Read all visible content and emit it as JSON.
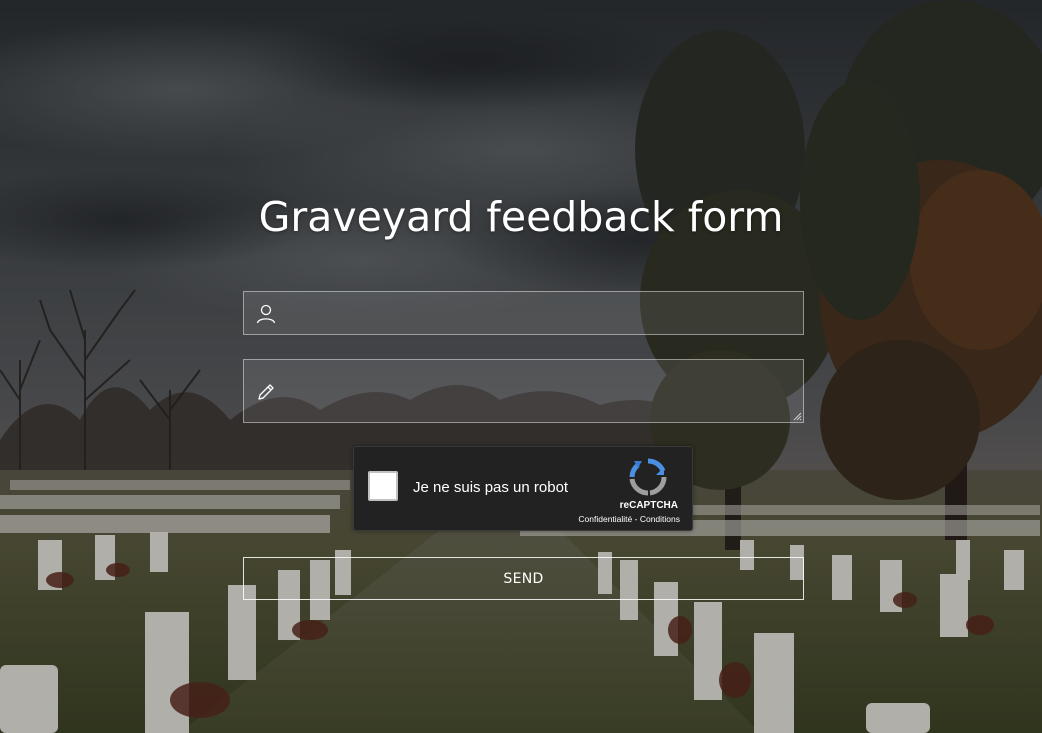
{
  "page": {
    "title": "Graveyard feedback form"
  },
  "form": {
    "name_icon": "user-icon",
    "message_icon": "pencil-icon",
    "name_value": "",
    "message_value": "",
    "send_label": "SEND"
  },
  "captcha": {
    "checkbox_label": "Je ne suis pas un robot",
    "brand": "reCAPTCHA",
    "privacy_link": "Confidentialité",
    "separator": " - ",
    "terms_link": "Conditions",
    "logo_icon": "recaptcha-logo-icon"
  },
  "colors": {
    "title_text": "#ffffff",
    "field_border": "#ffffff",
    "captcha_bg": "#222222",
    "recaptcha_blue": "#4a90e2",
    "recaptcha_grey": "#9e9e9e"
  }
}
